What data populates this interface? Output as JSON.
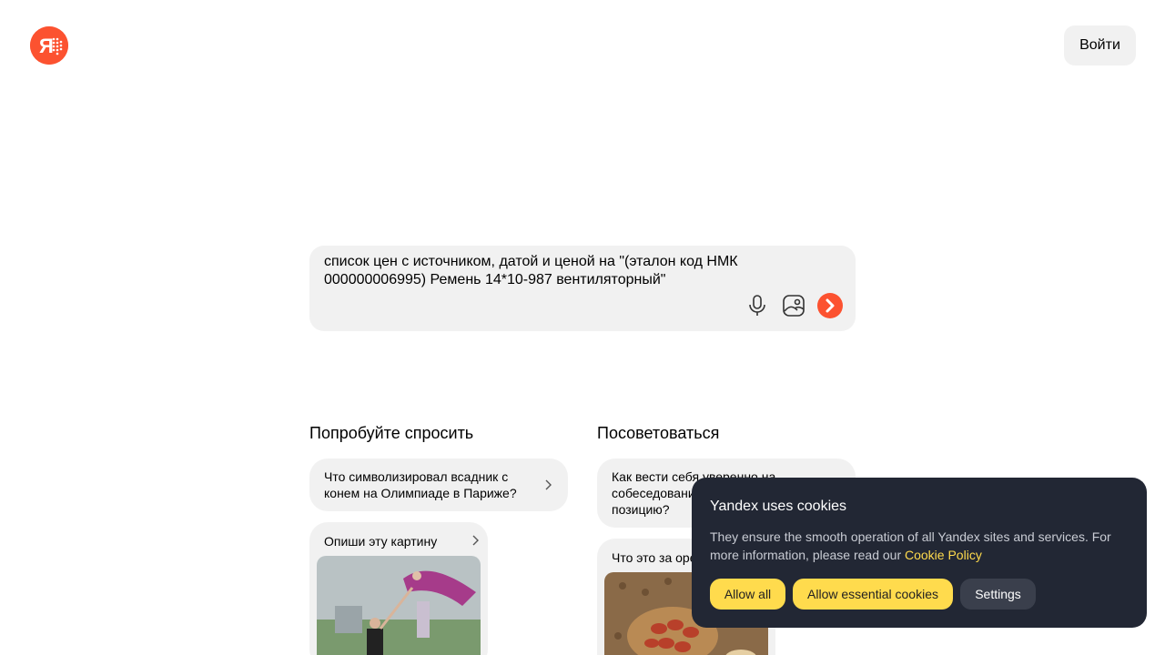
{
  "header": {
    "logo_label": "Я",
    "login_label": "Войти"
  },
  "search": {
    "query": "список цен с источником, датой и ценой на \"(эталон код НМК 000000006995) Ремень 14*10-987 вентиляторный\"",
    "icons": [
      "microphone-icon",
      "image-search-icon",
      "arrow-right-icon"
    ]
  },
  "suggest": {
    "left_title": "Попробуйте спросить",
    "right_title": "Посоветоваться",
    "left_cards": [
      {
        "text": "Что символизировал всадник с конем на Олимпиаде в Париже?"
      },
      {
        "text": "Опиши эту картину"
      }
    ],
    "right_cards": [
      {
        "text": "Как вести себя уверенно на собеседовании на менеджерскую позицию?"
      },
      {
        "text": "Что это за орехи?"
      }
    ]
  },
  "cookie": {
    "title": "Yandex uses cookies",
    "body": "They ensure the smooth operation of all Yandex sites and services. For more information, please read our ",
    "link": "Cookie Policy",
    "allow_all": "Allow all",
    "allow_essential": "Allow essential cookies",
    "settings": "Settings"
  },
  "colors": {
    "brand": "#fc5230",
    "surface": "#f1f1f1",
    "cookie_bg": "#222734",
    "cookie_accent": "#ffdb4d"
  }
}
